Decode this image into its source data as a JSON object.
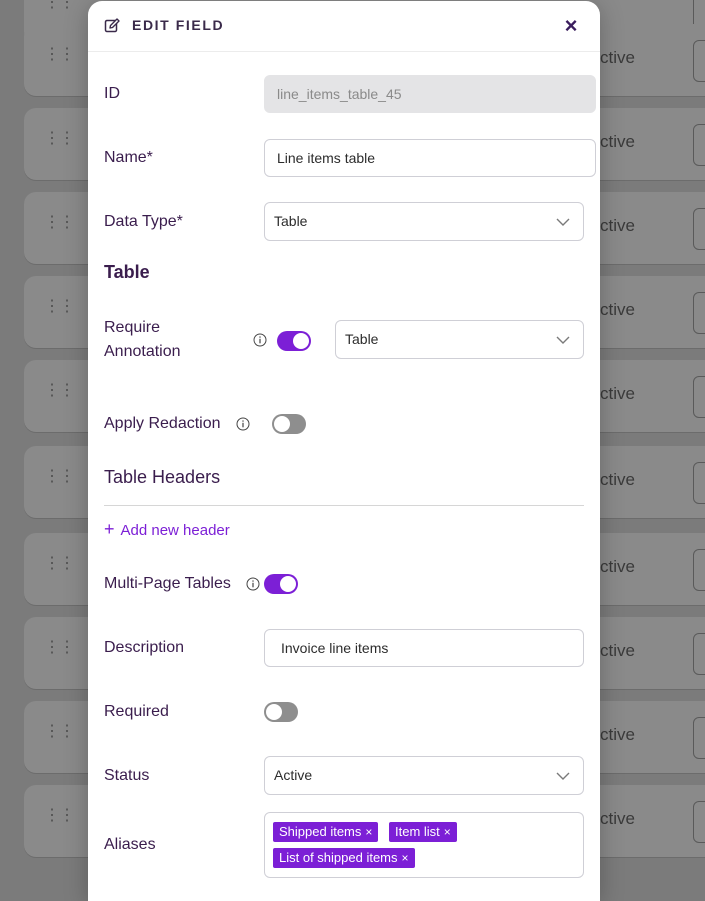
{
  "background": {
    "rows_status": [
      "ctive",
      "ctive",
      "ctive",
      "ctive",
      "ctive",
      "ctive",
      "ctive",
      "ctive",
      "ctive",
      "ctive"
    ]
  },
  "modal": {
    "title": "EDIT FIELD",
    "close_symbol": "×",
    "id": {
      "label": "ID",
      "value": "line_items_table_45"
    },
    "name": {
      "label": "Name*",
      "value": "Line items table"
    },
    "data_type": {
      "label": "Data Type*",
      "value": "Table"
    },
    "table_section_title": "Table",
    "require_annotation": {
      "label_line1": "Require",
      "label_line2": "Annotation",
      "enabled": true,
      "select_value": "Table"
    },
    "apply_redaction": {
      "label": "Apply Redaction",
      "enabled": false
    },
    "table_headers_title": "Table Headers",
    "add_header_label": "Add new header",
    "add_header_symbol": "+",
    "multi_page": {
      "label": "Multi-Page Tables",
      "enabled": true
    },
    "description": {
      "label": "Description",
      "value": "Invoice line items"
    },
    "required": {
      "label": "Required",
      "enabled": false
    },
    "status": {
      "label": "Status",
      "value": "Active"
    },
    "aliases": {
      "label": "Aliases",
      "chips": [
        "Shipped items",
        "Item list",
        "List of shipped items"
      ],
      "remove_symbol": "×"
    }
  },
  "colors": {
    "accent": "#7c1fd6",
    "text": "#3a1d4d"
  }
}
